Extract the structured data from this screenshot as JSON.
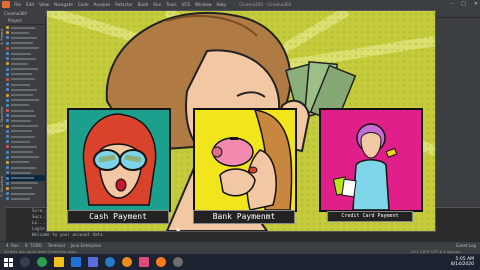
{
  "ide": {
    "menu": [
      "File",
      "Edit",
      "View",
      "Navigate",
      "Code",
      "Analyze",
      "Refactor",
      "Build",
      "Run",
      "Tools",
      "VCS",
      "Window",
      "Help"
    ],
    "window_title": "Cinema360 - Cinema360",
    "crumb": "Cinema360",
    "side_tabs": [
      "1: Project",
      "2: Favorites",
      "7: Structure"
    ],
    "project_header": "Project",
    "run_lines": [
      "Scre...",
      "Succ...",
      "Lo...",
      "Login Successful!",
      "Welcome to your account data"
    ],
    "bottom_tabs": [
      "4: Run",
      "6: TODO",
      "Terminal",
      "Java Enterprise"
    ],
    "bottom_right": [
      "Event Log"
    ],
    "status_text": "All files are up-to-date (moments ago)",
    "status_right": "29:1  CRLF  UTF-8  4 spaces",
    "colors": {
      "ide_bg": "#3c3f41",
      "editor_bg": "#2b2b2b",
      "app_bg": "#c4cc3c"
    }
  },
  "app": {
    "cards": [
      {
        "label": "Cash Payment",
        "bg": "#1c9f8c"
      },
      {
        "label": "Bank Paymenmt",
        "bg": "#f3e51c"
      },
      {
        "label": "Credit Card Payment",
        "bg": "#e01f8a"
      }
    ]
  },
  "taskbar": {
    "time": "5:05 AM",
    "date": "8/14/2020",
    "apps": [
      "start",
      "search",
      "chrome",
      "files",
      "mail",
      "store",
      "photos",
      "vlc",
      "intellij",
      "firefox",
      "settings"
    ]
  }
}
